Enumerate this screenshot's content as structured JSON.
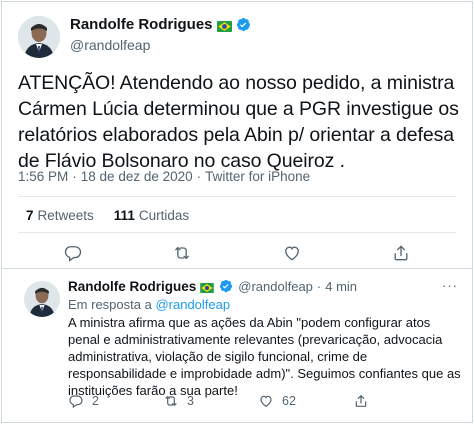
{
  "main_tweet": {
    "author_name": "Randolfe Rodrigues",
    "author_handle": "@randolfeap",
    "text": "ATENÇÃO! Atendendo ao nosso pedido, a ministra Cármen Lúcia determinou que a PGR investigue os relatórios elaborados pela Abin p/ orientar a defesa de Flávio Bolsonaro no caso Queiroz .",
    "time": "1:56 PM",
    "date": "18 de dez de 2020",
    "source": "Twitter for iPhone",
    "separator": "·",
    "retweets_count": "7",
    "retweets_label": "Retweets",
    "likes_count": "111",
    "likes_label": "Curtidas"
  },
  "reply_tweet": {
    "author_name": "Randolfe Rodrigues",
    "author_handle": "@randolfeap",
    "separator": "·",
    "time": "4 min",
    "more": "···",
    "replying_prefix": "Em resposta a",
    "replying_to": "@randolfeap",
    "text": "A ministra afirma que as ações da Abin \"podem configurar atos penal e administrativamente relevantes (prevaricação, advocacia administrativa, violação de sigilo funcional, crime de responsabilidade e improbidade adm)\". Seguimos confiantes que as instituições farão a sua parte!",
    "reply_count": "2",
    "retweet_count": "3",
    "like_count": "62"
  },
  "icons": {
    "flag": "brazil-flag-icon",
    "verified": "verified-badge-icon",
    "reply": "reply-icon",
    "retweet": "retweet-icon",
    "like": "heart-icon",
    "share": "share-icon"
  },
  "colors": {
    "accent": "#1d9bf0",
    "text": "#0f1419",
    "secondary": "#536471",
    "border": "#cfd9de"
  }
}
